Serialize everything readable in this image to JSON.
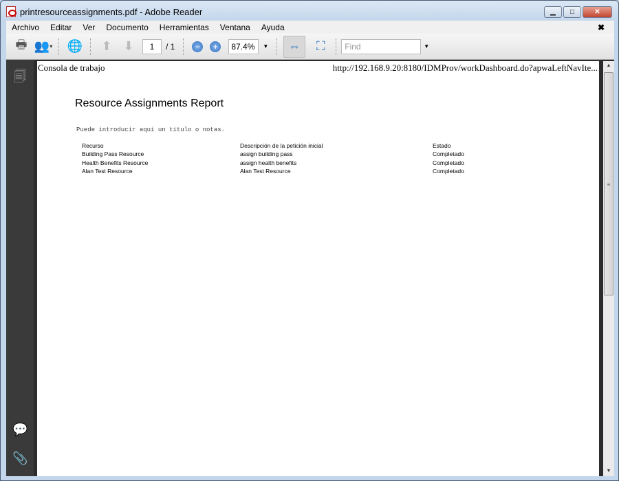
{
  "window": {
    "title": "printresourceassignments.pdf - Adobe Reader"
  },
  "menu": [
    "Archivo",
    "Editar",
    "Ver",
    "Documento",
    "Herramientas",
    "Ventana",
    "Ayuda"
  ],
  "toolbar": {
    "page_current": "1",
    "page_total": "/ 1",
    "zoom": "87.4%",
    "find_placeholder": "Find"
  },
  "page": {
    "header_left": "Consola de trabajo",
    "header_right": "http://192.168.9.20:8180/IDMProv/workDashboard.do?apwaLeftNavIte...",
    "title": "Resource Assignments Report",
    "notes": "Puede introducir aquí un título o notas.",
    "table": {
      "headers": [
        "Recurso",
        "Descripción de la petición inicial",
        "Estado"
      ],
      "rows": [
        [
          "Building Pass Resource",
          "assign building pass",
          "Completado"
        ],
        [
          "Health Benefits Resource",
          "assign health benefits",
          "Completado"
        ],
        [
          "Alan Test Resource",
          "Alan Test Resource",
          "Completado"
        ]
      ]
    }
  }
}
